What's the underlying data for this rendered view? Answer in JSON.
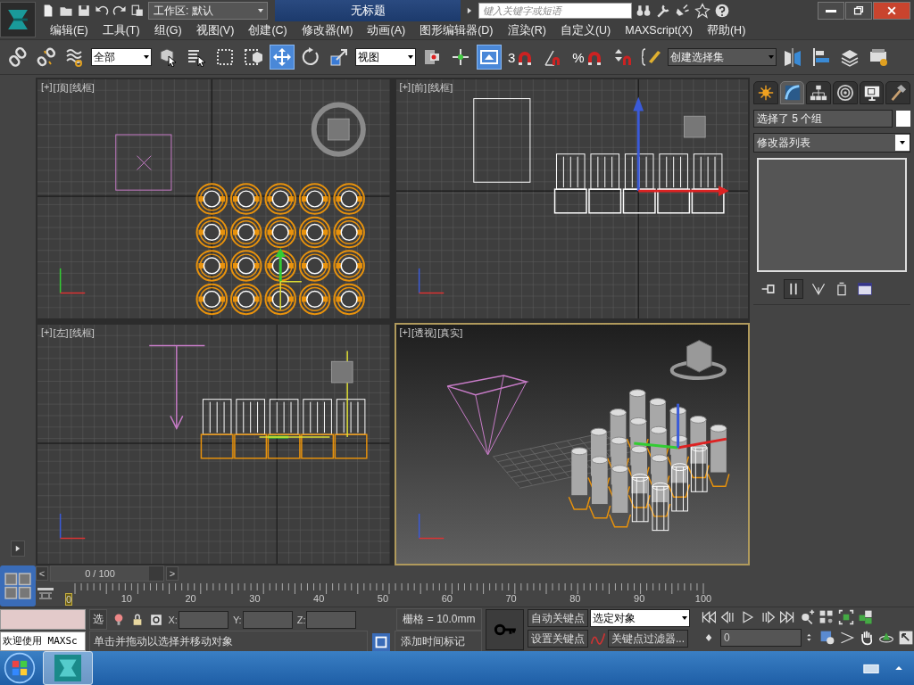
{
  "title_bar": {
    "workspace": "工作区: 默认",
    "title": "无标题",
    "search": {
      "placeholder": "键入关键字或短语"
    }
  },
  "menu": [
    "编辑(E)",
    "工具(T)",
    "组(G)",
    "视图(V)",
    "创建(C)",
    "修改器(M)",
    "动画(A)",
    "图形编辑器(D)",
    "渲染(R)",
    "自定义(U)",
    "MAXScript(X)",
    "帮助(H)"
  ],
  "toolbar": [
    {
      "kind": "link",
      "selected": false
    },
    {
      "kind": "unlink",
      "selected": false
    },
    {
      "kind": "bind",
      "selected": false
    },
    {
      "kind": "dropdown",
      "value": "全部"
    },
    {
      "kind": "select",
      "selected": false
    },
    {
      "kind": "select_by_name",
      "selected": false
    },
    {
      "kind": "region",
      "selected": false
    },
    {
      "kind": "crossing",
      "selected": false
    },
    {
      "kind": "move",
      "selected": true
    },
    {
      "kind": "rotate",
      "selected": false
    },
    {
      "kind": "scale",
      "selected": false
    },
    {
      "kind": "dropdown",
      "value": "视图"
    },
    {
      "kind": "pivot",
      "selected": false
    },
    {
      "kind": "manipulate",
      "selected": false
    },
    {
      "kind": "shortcut",
      "selected": true
    },
    {
      "kind": "snap",
      "label": "3",
      "selected": false
    },
    {
      "kind": "angle_snap",
      "selected": false
    },
    {
      "kind": "snap",
      "label": "%",
      "selected": false
    },
    {
      "kind": "spinner_snap",
      "selected": false
    },
    {
      "kind": "named_sets",
      "selected": false
    },
    {
      "kind": "named_dropdown",
      "value": "创建选择集"
    },
    {
      "kind": "mirror",
      "selected": false
    },
    {
      "kind": "align",
      "selected": false
    },
    {
      "kind": "layers",
      "selected": false
    },
    {
      "kind": "render_setup",
      "selected": false
    }
  ],
  "viewports": [
    {
      "kind": "top",
      "labels": [
        "[+]",
        "[顶]",
        "[线框]"
      ],
      "selected": false
    },
    {
      "kind": "front",
      "labels": [
        "[+]",
        "[前]",
        "[线框]"
      ],
      "selected": false
    },
    {
      "kind": "left",
      "labels": [
        "[+]",
        "[左]",
        "[线框]"
      ],
      "selected": false
    },
    {
      "kind": "perspective",
      "labels": [
        "[+]",
        "[透视]",
        "[真实]"
      ],
      "selected": true
    }
  ],
  "command_panel": {
    "tabs": [
      {
        "kind": "create",
        "selected": false
      },
      {
        "kind": "modify",
        "selected": true
      },
      {
        "kind": "hierarchy",
        "selected": false
      },
      {
        "kind": "motion",
        "selected": false
      },
      {
        "kind": "display",
        "selected": false
      },
      {
        "kind": "utilities",
        "selected": false
      }
    ],
    "name": "选择了 5 个组",
    "modifier_list": "修改器列表"
  },
  "time_slider": {
    "prev": "<",
    "position": "0 / 100",
    "next": ">"
  },
  "track_bar": {
    "ticks": [
      "0",
      "10",
      "20",
      "30",
      "40",
      "50",
      "60",
      "70",
      "80",
      "90",
      "100"
    ]
  },
  "status": {
    "script_output": "欢迎使用 MAXSc",
    "selection": "选",
    "x": "X:",
    "y": "Y:",
    "z": "Z:",
    "grid": "栅格 = 10.0mm",
    "prompt": "单击并拖动以选择并移动对象",
    "time_tag": "添加时间标记"
  },
  "animation": {
    "auto_key": "自动关键点",
    "set_key": "设置关键点",
    "key_mode": "选定对象",
    "key_filters": "关键点过滤器...",
    "frame": "0"
  }
}
